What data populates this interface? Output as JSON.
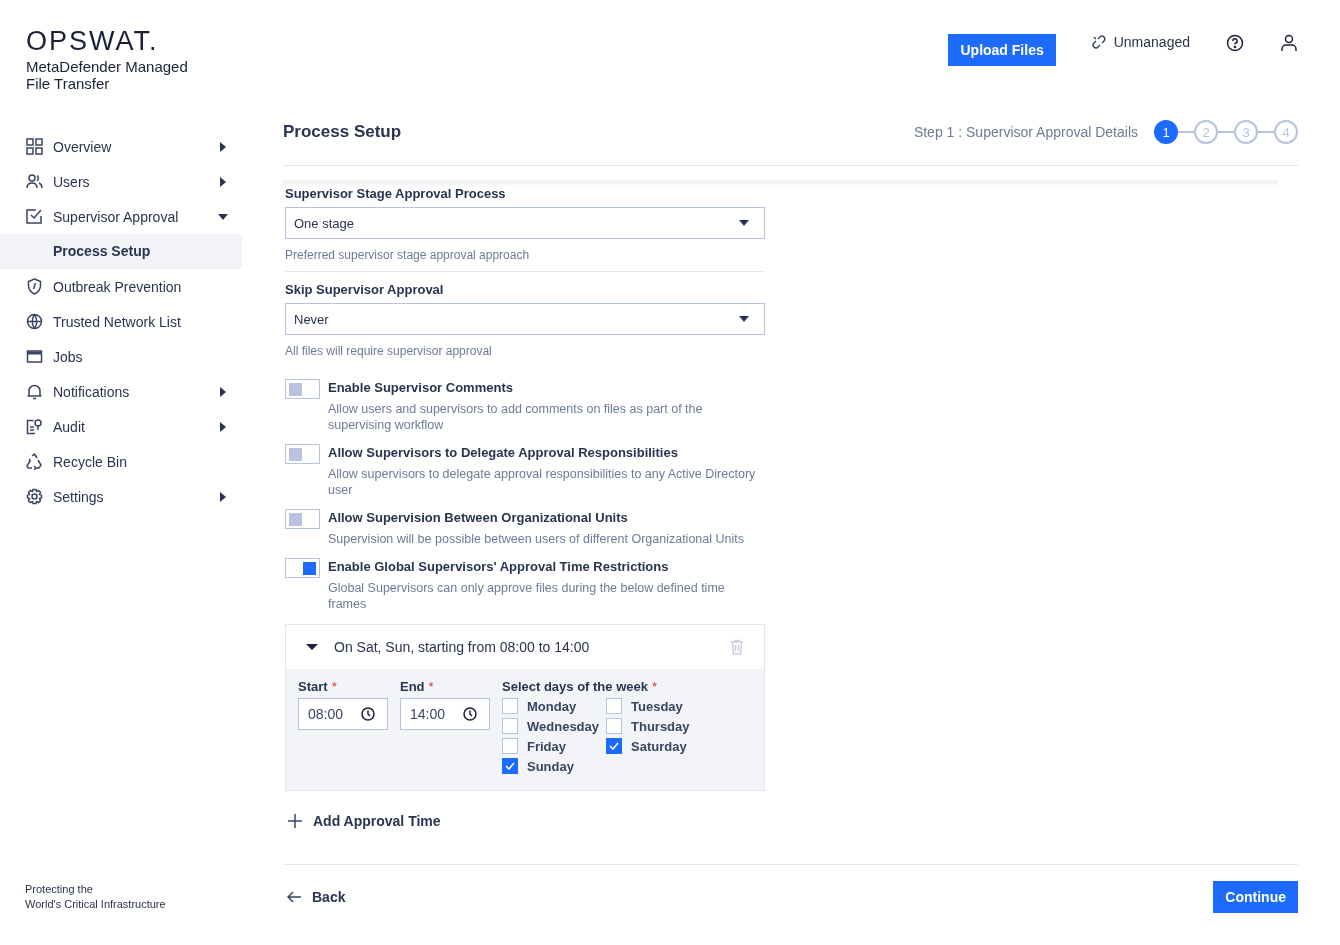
{
  "brand": {
    "logo": "OPSWAT.",
    "product": "MetaDefender Managed File Transfer",
    "tagline": [
      "Protecting the",
      "World's Critical Infrastructure"
    ]
  },
  "sidebar": {
    "items": [
      {
        "label": "Overview",
        "kind": "group",
        "expanded": false,
        "selected": false
      },
      {
        "label": "Users",
        "kind": "group",
        "expanded": false,
        "selected": false
      },
      {
        "label": "Supervisor Approval",
        "kind": "group",
        "expanded": true,
        "selected": false,
        "children": [
          {
            "label": "Process Setup",
            "selected": true
          }
        ]
      },
      {
        "label": "Outbreak Prevention",
        "kind": "link",
        "selected": false
      },
      {
        "label": "Trusted Network List",
        "kind": "link",
        "selected": false
      },
      {
        "label": "Jobs",
        "kind": "link",
        "selected": false
      },
      {
        "label": "Notifications",
        "kind": "group",
        "expanded": false,
        "selected": false
      },
      {
        "label": "Audit",
        "kind": "group",
        "expanded": false,
        "selected": false
      },
      {
        "label": "Recycle Bin",
        "kind": "link",
        "selected": false
      },
      {
        "label": "Settings",
        "kind": "group",
        "expanded": false,
        "selected": false
      }
    ]
  },
  "header": {
    "upload_button": "Upload Files",
    "mode": "Unmanaged"
  },
  "page": {
    "title": "Process Setup",
    "step_label": "Step 1 : Supervisor Approval Details",
    "steps": [
      {
        "number": "1",
        "selected": true
      },
      {
        "number": "2",
        "selected": false
      },
      {
        "number": "3",
        "selected": false
      },
      {
        "number": "4",
        "selected": false
      }
    ]
  },
  "selects": [
    {
      "label": "Supervisor Stage Approval Process",
      "value": "One stage",
      "help": "Preferred supervisor stage approval approach"
    },
    {
      "label": "Skip Supervisor Approval",
      "value": "Never",
      "help": "All files will require supervisor approval"
    }
  ],
  "toggles": [
    {
      "label": "Enable Supervisor Comments",
      "description": "Allow users and supervisors to add comments on files as part of the supervising workflow",
      "on": false
    },
    {
      "label": "Allow Supervisors to Delegate Approval Responsibilities",
      "description": "Allow supervisors to delegate approval responsibilities to any Active Directory user",
      "on": false
    },
    {
      "label": "Allow Supervision Between Organizational Units",
      "description": "Supervision will be possible between users of different Organizational Units",
      "on": false
    },
    {
      "label": "Enable Global Supervisors' Approval Time Restrictions",
      "description": "Global Supervisors can only approve files during the below defined time frames",
      "on": true
    }
  ],
  "time_rule": {
    "summary": "On Sat, Sun, starting from 08:00 to 14:00",
    "expanded": true,
    "start": {
      "label": "Start",
      "required": "*",
      "value": "08:00"
    },
    "end": {
      "label": "End",
      "required": "*",
      "value": "14:00"
    },
    "days_label": {
      "label": "Select days of the week",
      "required": "*"
    },
    "days": [
      {
        "label": "Monday",
        "checked": false
      },
      {
        "label": "Tuesday",
        "checked": false
      },
      {
        "label": "Wednesday",
        "checked": false
      },
      {
        "label": "Thursday",
        "checked": false
      },
      {
        "label": "Friday",
        "checked": false
      },
      {
        "label": "Saturday",
        "checked": true
      },
      {
        "label": "Sunday",
        "checked": true
      }
    ]
  },
  "add_time": "Add Approval Time",
  "footer": {
    "back": "Back",
    "continue": "Continue"
  }
}
